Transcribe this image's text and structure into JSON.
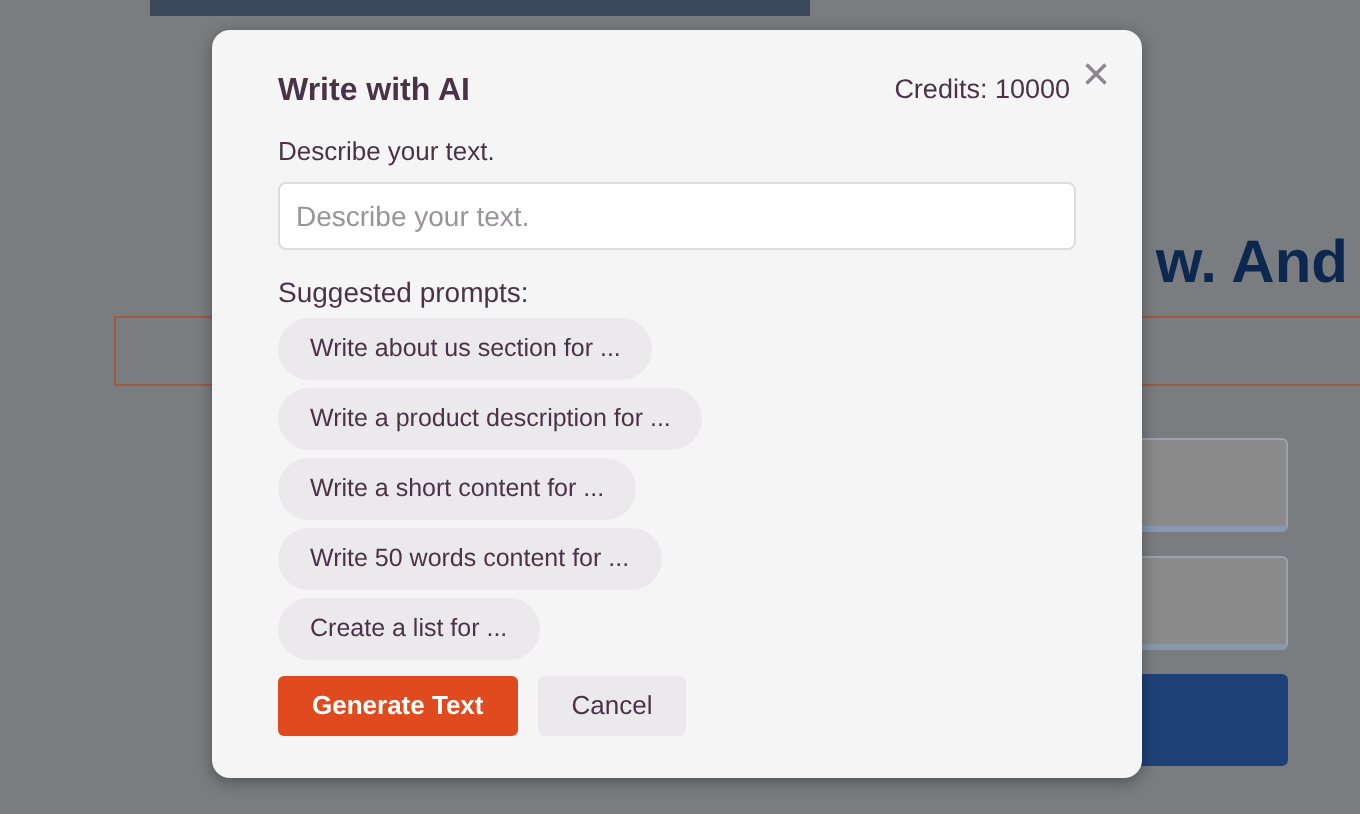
{
  "background_page": {
    "heading": "w. And"
  },
  "dialog": {
    "title": "Write with AI",
    "credits": "Credits: 10000",
    "close": "×",
    "field_label": "Describe your text.",
    "field": {
      "placeholder": "Describe your text."
    },
    "prompts_label": "Suggested prompts:",
    "prompts": [
      {
        "label": "Write about us section for ..."
      },
      {
        "label": "Write a product description for ..."
      },
      {
        "label": "Write a short content for ..."
      },
      {
        "label": "Write 50 words content for ..."
      },
      {
        "label": "Create a list for ..."
      }
    ],
    "buttons": [
      {
        "label": "Generate Text",
        "kind": "primary"
      },
      {
        "label": "Cancel",
        "kind": "secondary"
      }
    ]
  }
}
